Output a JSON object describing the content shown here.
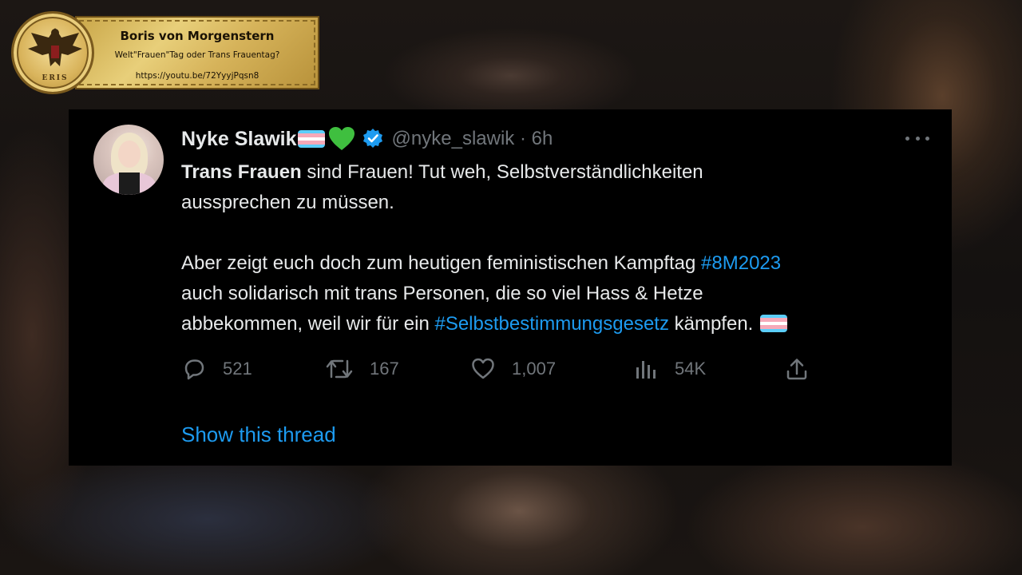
{
  "banner": {
    "title": "Boris von Morgenstern",
    "subtitle": "Welt\"Frauen\"Tag oder Trans Frauentag?",
    "link": "https://youtu.be/72YyyjPqsn8",
    "seal_text": "ERIS",
    "colors": {
      "gold": "#d6b35a",
      "dark": "#6b4e17"
    }
  },
  "tweet": {
    "author_name": "Nyke Slawik",
    "handle": "@nyke_slawik · 6h",
    "body": {
      "line1_bold": "Trans Frauen",
      "line1_rest": " sind Frauen! Tut weh, Selbstverständlichkeiten",
      "line2": "aussprechen zu müssen.",
      "line3_pre": "Aber zeigt euch doch zum heutigen feministischen Kampftag ",
      "hashtag1": "#8M2023",
      "line4": "auch solidarisch mit trans Personen, die so viel Hass & Hetze",
      "line5_pre": "abbekommen, weil wir für ein ",
      "hashtag2": "#Selbstbestimmungsgesetz",
      "line5_post": " kämpfen."
    },
    "actions": {
      "replies": "521",
      "retweets": "167",
      "likes": "1,007",
      "views": "54K"
    },
    "show_thread": "Show this thread",
    "icons": {
      "verified": "verified-badge-icon",
      "heart_emoji": "green-heart-icon",
      "flag": "transgender-flag-icon",
      "more": "more-options-icon",
      "reply": "reply-icon",
      "retweet": "retweet-icon",
      "like": "like-icon",
      "views": "views-icon",
      "share": "share-icon"
    },
    "colors": {
      "background": "#000000",
      "text": "#e7e9ea",
      "secondary": "#71767b",
      "accent": "#1d9bf0",
      "flag_blue": "#5bcefa",
      "flag_pink": "#f5a9b8",
      "flag_white": "#ffffff",
      "heart": "#3fbf3f"
    }
  }
}
